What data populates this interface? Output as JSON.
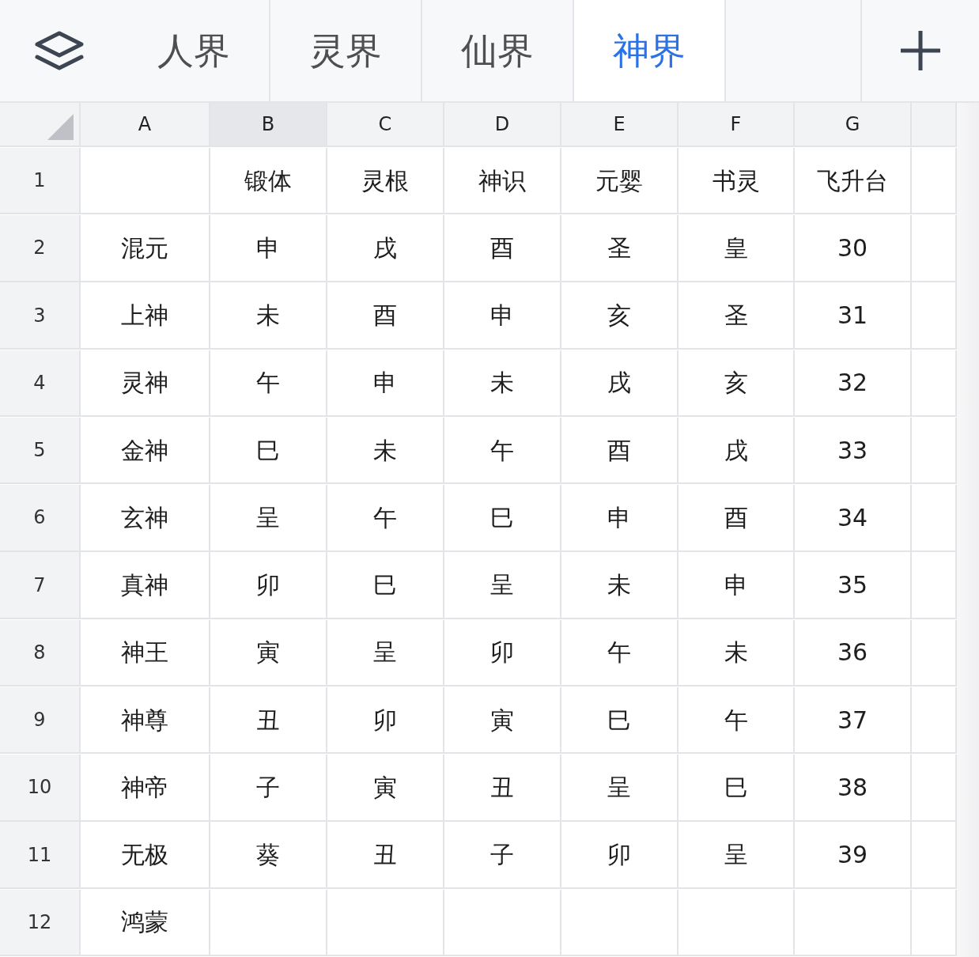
{
  "toolbar": {
    "tabs": [
      {
        "label": "人界",
        "selected": false
      },
      {
        "label": "灵界",
        "selected": false
      },
      {
        "label": "仙界",
        "selected": false
      },
      {
        "label": "神界",
        "selected": true
      }
    ]
  },
  "sheet": {
    "columns": [
      {
        "label": "A",
        "selected": false
      },
      {
        "label": "B",
        "selected": true
      },
      {
        "label": "C",
        "selected": false
      },
      {
        "label": "D",
        "selected": false
      },
      {
        "label": "E",
        "selected": false
      },
      {
        "label": "F",
        "selected": false
      },
      {
        "label": "G",
        "selected": false
      }
    ],
    "rows": [
      {
        "number": "1",
        "cells": [
          null,
          "锻体",
          "灵根",
          "神识",
          "元婴",
          "书灵",
          "飞升台"
        ]
      },
      {
        "number": "2",
        "cells": [
          "混元",
          "申",
          "戌",
          "酉",
          "圣",
          "皇",
          "30"
        ]
      },
      {
        "number": "3",
        "cells": [
          "上神",
          "未",
          "酉",
          "申",
          "亥",
          "圣",
          "31"
        ]
      },
      {
        "number": "4",
        "cells": [
          "灵神",
          "午",
          "申",
          "未",
          "戌",
          "亥",
          "32"
        ]
      },
      {
        "number": "5",
        "cells": [
          "金神",
          "巳",
          "未",
          "午",
          "酉",
          "戌",
          "33"
        ]
      },
      {
        "number": "6",
        "cells": [
          "玄神",
          "呈",
          "午",
          "巳",
          "申",
          "酉",
          "34"
        ]
      },
      {
        "number": "7",
        "cells": [
          "真神",
          "卯",
          "巳",
          "呈",
          "未",
          "申",
          "35"
        ]
      },
      {
        "number": "8",
        "cells": [
          "神王",
          "寅",
          "呈",
          "卯",
          "午",
          "未",
          "36"
        ]
      },
      {
        "number": "9",
        "cells": [
          "神尊",
          "丑",
          "卯",
          "寅",
          "巳",
          "午",
          "37"
        ]
      },
      {
        "number": "10",
        "cells": [
          "神帝",
          "子",
          "寅",
          "丑",
          "呈",
          "巳",
          "38"
        ]
      },
      {
        "number": "11",
        "cells": [
          "无极",
          "葵",
          "丑",
          "子",
          "卯",
          "呈",
          "39"
        ]
      },
      {
        "number": "12",
        "cells": [
          "鸿蒙"
        ]
      }
    ]
  }
}
